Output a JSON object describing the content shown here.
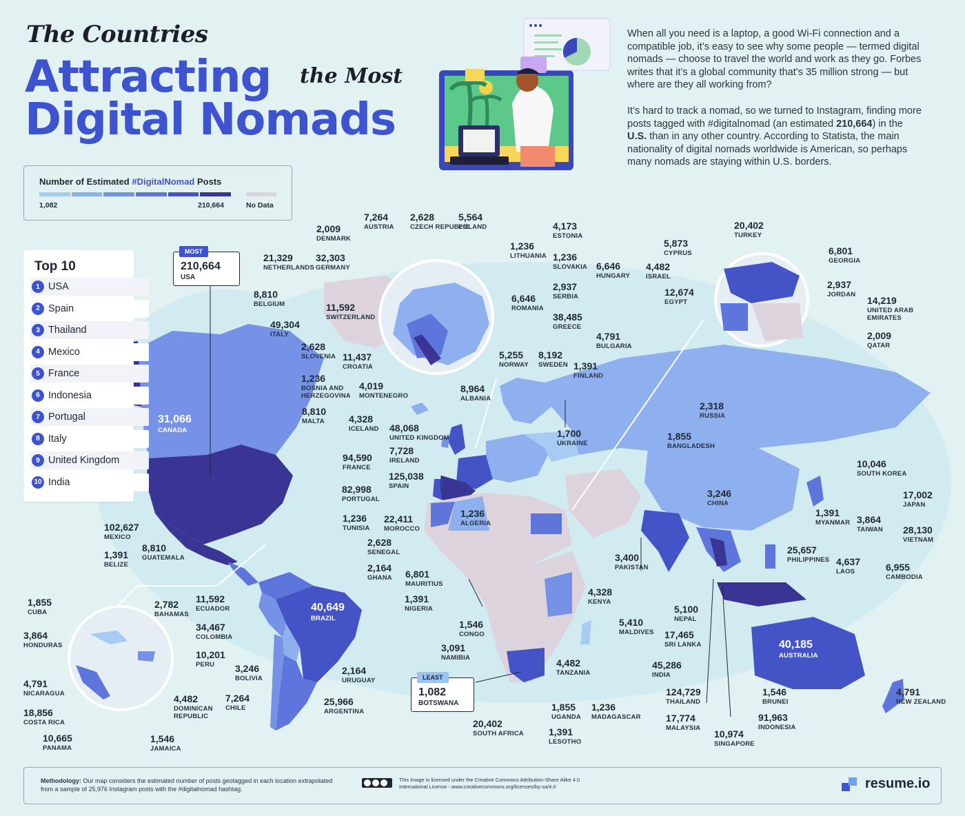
{
  "title": {
    "line1": "The Countries",
    "line2": "Attracting",
    "line2b": "the Most",
    "line3": "Digital Nomads"
  },
  "intro": {
    "p1": "When all you need is a laptop, a good Wi-Fi connection and a compatible job, it’s easy to see why some people — termed digital nomads — choose to travel the world and work as they go. Forbes writes that it’s a global community that’s 35 million strong — but where are they all working from?",
    "p2a": "It’s hard to track a nomad, so we turned to Instagram, finding more posts tagged with #digitalnomad (an estimated ",
    "p2b": "210,664",
    "p2c": ") in the ",
    "p2d": "U.S.",
    "p2e": " than in any other country. According to Statista, the main nationality of digital nomads worldwide is American, so perhaps many nomads are staying within U.S. borders."
  },
  "legend": {
    "title_pre": "Number of Estimated ",
    "title_tag": "#DigitalNomad",
    "title_post": " Posts",
    "min": "1,082",
    "max": "210,664",
    "nodata": "No Data",
    "colors": [
      "#a8cbf3",
      "#8fb0ee",
      "#7592e6",
      "#5e76dc",
      "#4454c6",
      "#3a3594"
    ],
    "nodata_color": "#dcd3dc"
  },
  "top10": {
    "heading": "Top 10",
    "items": [
      "USA",
      "Spain",
      "Thailand",
      "Mexico",
      "France",
      "Indonesia",
      "Portugal",
      "Italy",
      "United Kingdom",
      "India"
    ]
  },
  "callouts": {
    "most_tag": "MOST",
    "most_value": "210,664",
    "most_name": "USA",
    "least_tag": "LEAST",
    "least_value": "1,082",
    "least_name": "BOTSWANA"
  },
  "labels": [
    {
      "v": "7,264",
      "n": "AUSTRIA"
    },
    {
      "v": "2,628",
      "n": "CZECH REPUBLIC"
    },
    {
      "v": "5,564",
      "n": "POLAND"
    },
    {
      "v": "2,009",
      "n": "DENMARK"
    },
    {
      "v": "4,173",
      "n": "ESTONIA"
    },
    {
      "v": "1,236",
      "n": "LITHUANIA"
    },
    {
      "v": "1,236",
      "n": "SLOVAKIA"
    },
    {
      "v": "21,329",
      "n": "NETHERLANDS"
    },
    {
      "v": "32,303",
      "n": "GERMANY"
    },
    {
      "v": "6,646",
      "n": "HUNGARY"
    },
    {
      "v": "2,937",
      "n": "SERBIA"
    },
    {
      "v": "8,810",
      "n": "BELGIUM"
    },
    {
      "v": "6,646",
      "n": "ROMANIA"
    },
    {
      "v": "11,592",
      "n": "SWITZERLAND"
    },
    {
      "v": "38,485",
      "n": "GREECE"
    },
    {
      "v": "49,304",
      "n": "ITALY"
    },
    {
      "v": "4,791",
      "n": "BULGARIA"
    },
    {
      "v": "2,628",
      "n": "SLOVENIA"
    },
    {
      "v": "11,437",
      "n": "CROATIA"
    },
    {
      "v": "1,236",
      "n": "BOSNIA AND HERZEGOVINA"
    },
    {
      "v": "4,019",
      "n": "MONTENEGRO"
    },
    {
      "v": "8,964",
      "n": "ALBANIA"
    },
    {
      "v": "8,810",
      "n": "MALTA"
    },
    {
      "v": "5,255",
      "n": "NORWAY"
    },
    {
      "v": "8,192",
      "n": "SWEDEN"
    },
    {
      "v": "1,391",
      "n": "FINLAND"
    },
    {
      "v": "4,328",
      "n": "ICELAND"
    },
    {
      "v": "48,068",
      "n": "UNITED KINGDOM"
    },
    {
      "v": "7,728",
      "n": "IRELAND"
    },
    {
      "v": "94,590",
      "n": "FRANCE"
    },
    {
      "v": "125,038",
      "n": "SPAIN"
    },
    {
      "v": "82,998",
      "n": "PORTUGAL"
    },
    {
      "v": "1,236",
      "n": "TUNISIA"
    },
    {
      "v": "22,411",
      "n": "MOROCCO"
    },
    {
      "v": "1,236",
      "n": "ALGERIA"
    },
    {
      "v": "2,628",
      "n": "SENEGAL"
    },
    {
      "v": "2,164",
      "n": "GHANA"
    },
    {
      "v": "6,801",
      "n": "MAURITIUS"
    },
    {
      "v": "1,391",
      "n": "NIGERIA"
    },
    {
      "v": "1,546",
      "n": "CONGO"
    },
    {
      "v": "3,091",
      "n": "NAMIBIA"
    },
    {
      "v": "20,402",
      "n": "SOUTH AFRICA"
    },
    {
      "v": "1,391",
      "n": "LESOTHO"
    },
    {
      "v": "1,855",
      "n": "UGANDA"
    },
    {
      "v": "4,482",
      "n": "TANZANIA"
    },
    {
      "v": "4,328",
      "n": "KENYA"
    },
    {
      "v": "1,236",
      "n": "MADAGASCAR"
    },
    {
      "v": "1,700",
      "n": "UKRAINE"
    },
    {
      "v": "2,318",
      "n": "RUSSIA"
    },
    {
      "v": "1,855",
      "n": "BANGLADESH"
    },
    {
      "v": "10,046",
      "n": "SOUTH KOREA"
    },
    {
      "v": "17,002",
      "n": "JAPAN"
    },
    {
      "v": "3,246",
      "n": "CHINA"
    },
    {
      "v": "1,391",
      "n": "MYANMAR"
    },
    {
      "v": "3,864",
      "n": "TAIWAN"
    },
    {
      "v": "28,130",
      "n": "VIETNAM"
    },
    {
      "v": "25,657",
      "n": "PHILIPPINES"
    },
    {
      "v": "4,637",
      "n": "LAOS"
    },
    {
      "v": "6,955",
      "n": "CAMBODIA"
    },
    {
      "v": "3,400",
      "n": "PAKISTAN"
    },
    {
      "v": "5,410",
      "n": "MALDIVES"
    },
    {
      "v": "5,100",
      "n": "NEPAL"
    },
    {
      "v": "17,465",
      "n": "SRI LANKA"
    },
    {
      "v": "45,286",
      "n": "INDIA"
    },
    {
      "v": "124,729",
      "n": "THAILAND"
    },
    {
      "v": "17,774",
      "n": "MALAYSIA"
    },
    {
      "v": "10,974",
      "n": "SINGAPORE"
    },
    {
      "v": "91,963",
      "n": "INDONESIA"
    },
    {
      "v": "1,546",
      "n": "BRUNEI"
    },
    {
      "v": "40,185",
      "n": "AUSTRALIA"
    },
    {
      "v": "4,791",
      "n": "NEW ZEALAND"
    },
    {
      "v": "20,402",
      "n": "TURKEY"
    },
    {
      "v": "5,873",
      "n": "CYPRUS"
    },
    {
      "v": "6,801",
      "n": "GEORGIA"
    },
    {
      "v": "4,482",
      "n": "ISRAEL"
    },
    {
      "v": "2,937",
      "n": "JORDAN"
    },
    {
      "v": "12,674",
      "n": "EGYPT"
    },
    {
      "v": "14,219",
      "n": "UNITED ARAB EMIRATES"
    },
    {
      "v": "2,009",
      "n": "QATAR"
    },
    {
      "v": "31,066",
      "n": "CANADA"
    },
    {
      "v": "102,627",
      "n": "MEXICO"
    },
    {
      "v": "8,810",
      "n": "GUATEMALA"
    },
    {
      "v": "1,391",
      "n": "BELIZE"
    },
    {
      "v": "11,592",
      "n": "ECUADOR"
    },
    {
      "v": "34,467",
      "n": "COLOMBIA"
    },
    {
      "v": "10,201",
      "n": "PERU"
    },
    {
      "v": "3,246",
      "n": "BOLIVIA"
    },
    {
      "v": "40,649",
      "n": "BRAZIL"
    },
    {
      "v": "2,164",
      "n": "URUGUAY"
    },
    {
      "v": "7,264",
      "n": "CHILE"
    },
    {
      "v": "25,966",
      "n": "ARGENTINA"
    },
    {
      "v": "2,782",
      "n": "BAHAMAS"
    },
    {
      "v": "1,855",
      "n": "CUBA"
    },
    {
      "v": "3,864",
      "n": "HONDURAS"
    },
    {
      "v": "4,791",
      "n": "NICARAGUA"
    },
    {
      "v": "18,856",
      "n": "COSTA RICA"
    },
    {
      "v": "10,665",
      "n": "PANAMA"
    },
    {
      "v": "4,482",
      "n": "DOMINICAN REPUBLIC"
    },
    {
      "v": "1,546",
      "n": "JAMAICA"
    }
  ],
  "footer": {
    "method_label": "Methodology:",
    "method_text": " Our map considers the estimated number of posts geotagged in each location extrapolated from a sample of 25,976 Instagram posts with the #digitalnomad hashtag.",
    "license": "This image is licensed under the Creative Commons Attribution-Share Alike 4.0 International License - www.creativecommons.org/licenses/by-sa/4.0",
    "brand": "resume.io"
  },
  "icons": [
    "laptop-illustration",
    "creative-commons-icon",
    "resume-io-logo-icon"
  ]
}
